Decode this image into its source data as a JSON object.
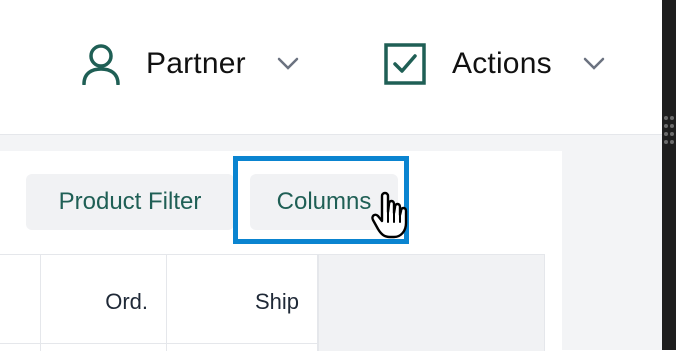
{
  "header": {
    "partner": {
      "label": "Partner",
      "icon": "user-icon"
    },
    "actions": {
      "label": "Actions",
      "icon": "checkbox-icon"
    }
  },
  "toolbar": {
    "product_filter_label": "Product Filter",
    "columns_label": "Columns"
  },
  "table": {
    "headers": [
      "",
      "Ord.",
      "Ship",
      ""
    ]
  },
  "colors": {
    "brand": "#1f5f55",
    "highlight": "#0a84d0"
  }
}
